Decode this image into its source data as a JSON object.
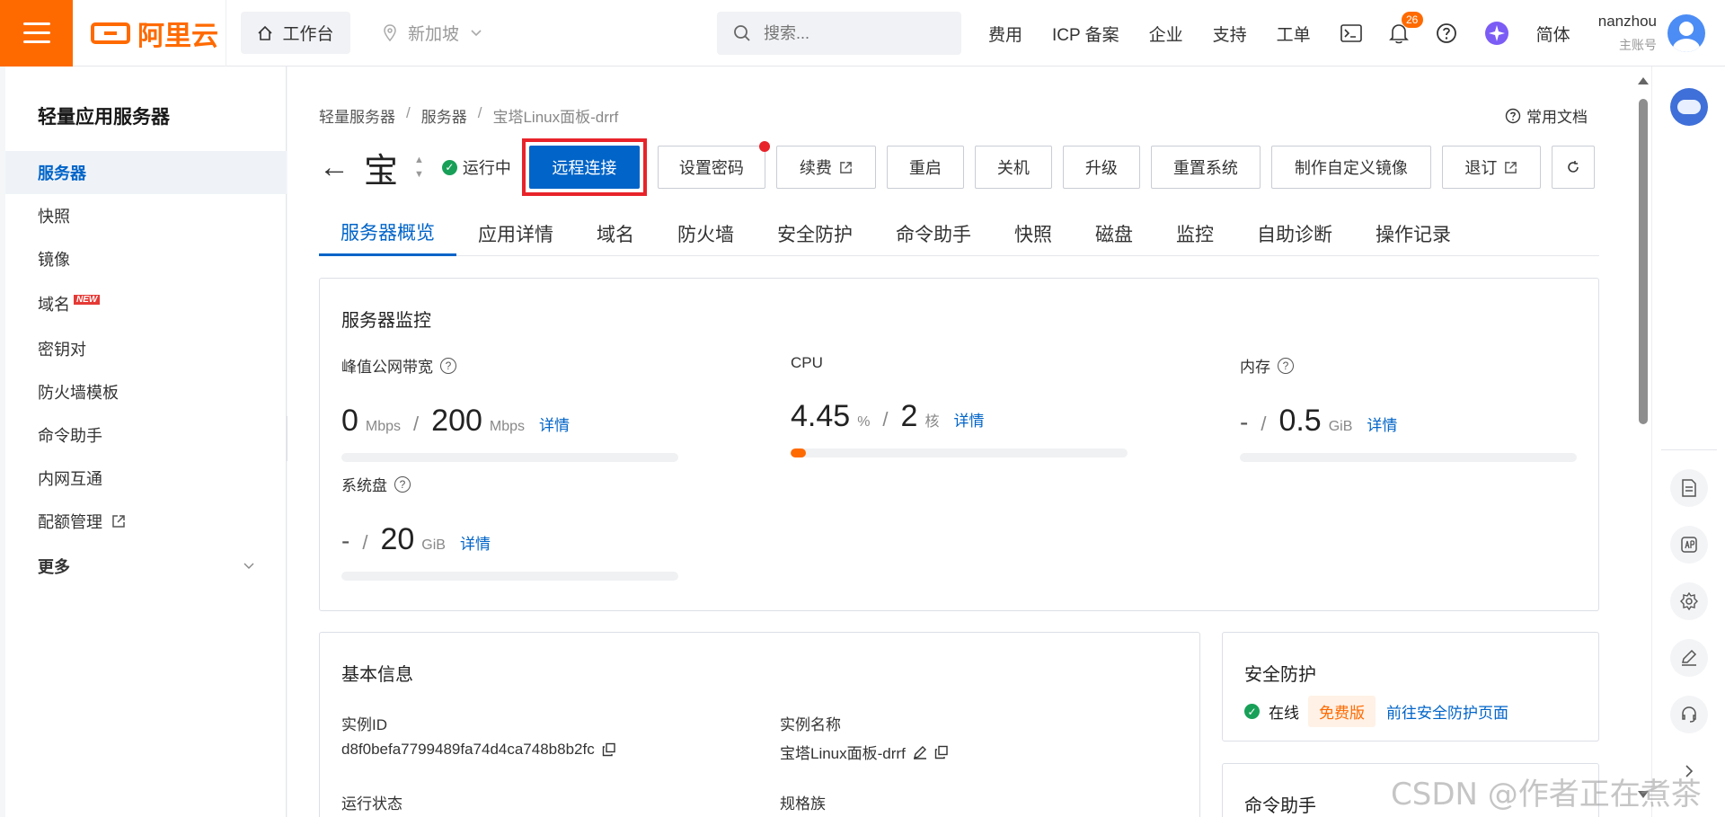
{
  "topbar": {
    "logo_text": "阿里云",
    "workbench": "工作台",
    "region": "新加坡",
    "search_placeholder": "搜索...",
    "links": [
      "费用",
      "ICP 备案",
      "企业",
      "支持",
      "工单"
    ],
    "notifications": "26",
    "lang": "简体",
    "username": "nanzhou",
    "role": "主账号"
  },
  "sidebar": {
    "title": "轻量应用服务器",
    "items": [
      {
        "label": "服务器"
      },
      {
        "label": "快照"
      },
      {
        "label": "镜像"
      },
      {
        "label": "域名",
        "tag": "NEW"
      },
      {
        "label": "密钥对"
      },
      {
        "label": "防火墙模板"
      },
      {
        "label": "命令助手"
      },
      {
        "label": "内网互通"
      },
      {
        "label": "配额管理"
      }
    ],
    "more": "更多"
  },
  "breadcrumb": [
    "轻量服务器",
    "服务器",
    "宝塔Linux面板-drrf"
  ],
  "docs_link": "常用文档",
  "instance": {
    "name": "宝",
    "status": "运行中"
  },
  "actions": {
    "remote": "远程连接",
    "set_password": "设置密码",
    "renew": "续费",
    "restart": "重启",
    "shutdown": "关机",
    "upgrade": "升级",
    "reset": "重置系统",
    "custom_image": "制作自定义镜像",
    "refund": "退订"
  },
  "tabs": [
    "服务器概览",
    "应用详情",
    "域名",
    "防火墙",
    "安全防护",
    "命令助手",
    "快照",
    "磁盘",
    "监控",
    "自助诊断",
    "操作记录"
  ],
  "monitor": {
    "title": "服务器监控",
    "bandwidth": {
      "label": "峰值公网带宽",
      "used": "0",
      "used_unit": "Mbps",
      "total": "200",
      "total_unit": "Mbps",
      "link": "详情",
      "usage_fraction": 0
    },
    "cpu": {
      "label": "CPU",
      "used": "4.45",
      "used_unit": "%",
      "total": "2",
      "total_unit": "核",
      "link": "详情",
      "usage_fraction": 0.0445
    },
    "memory": {
      "label": "内存",
      "used": "-",
      "total": "0.5",
      "total_unit": "GiB",
      "link": "详情",
      "usage_fraction": 0
    },
    "disk": {
      "label": "系统盘",
      "used": "-",
      "total": "20",
      "total_unit": "GiB",
      "link": "详情",
      "usage_fraction": 0
    }
  },
  "basic_info": {
    "title": "基本信息",
    "instance_id_label": "实例ID",
    "instance_id": "d8f0befa7799489fa74d4ca748b8b2fc",
    "instance_name_label": "实例名称",
    "instance_name": "宝塔Linux面板-drrf",
    "run_status_label": "运行状态",
    "spec_label": "规格族"
  },
  "security": {
    "title": "安全防护",
    "status": "在线",
    "tier": "免费版",
    "link": "前往安全防护页面"
  },
  "command_helper": {
    "title": "命令助手"
  },
  "watermark": "CSDN @作者正在煮茶",
  "colors": {
    "brand": "#ff6a00",
    "primary": "#0064c8",
    "highlight": "#e8232a",
    "ok": "#18a058"
  }
}
